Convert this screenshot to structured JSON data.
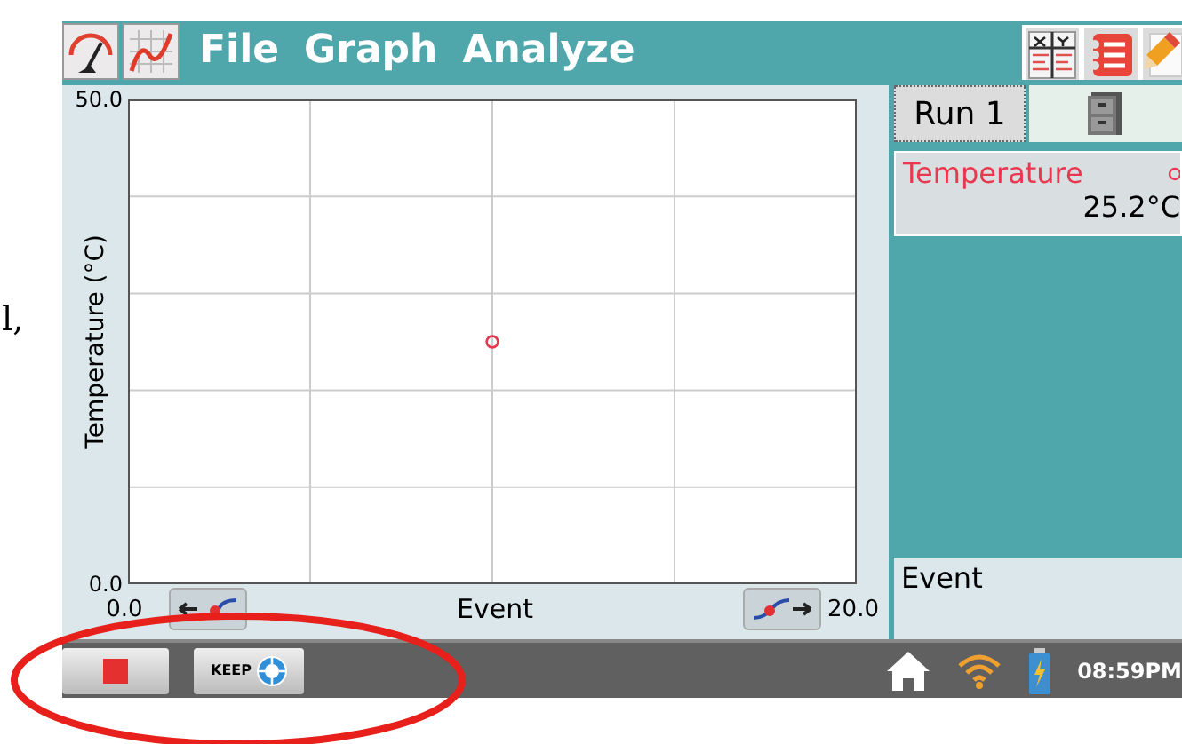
{
  "margin_text": "l,",
  "menu_bar": {
    "items": [
      {
        "label": "File"
      },
      {
        "label": "Graph"
      },
      {
        "label": "Analyze"
      }
    ]
  },
  "graph": {
    "chart_data": {
      "type": "scatter",
      "xlabel": "Event",
      "ylabel": "Temperature (°C)",
      "x": [
        10
      ],
      "series": [
        {
          "color": "#e8384f",
          "values": [
            25
          ]
        }
      ],
      "xlim": [
        0,
        20
      ],
      "ylim": [
        0,
        50
      ],
      "xticks": [
        {
          "value": 0,
          "label": "0.0"
        },
        {
          "value": 20,
          "label": "20.0"
        }
      ],
      "yticks": [
        {
          "value": 0,
          "label": "0.0"
        },
        {
          "value": 50,
          "label": "50.0"
        }
      ]
    }
  },
  "side_panel": {
    "run_button": "Run 1",
    "meter": {
      "name": "Temperature",
      "value": "25.2°C",
      "color": "#e8384f"
    },
    "event_label": "Event"
  },
  "taskbar": {
    "keep_button": "KEEP",
    "clock": "08:59PM"
  }
}
